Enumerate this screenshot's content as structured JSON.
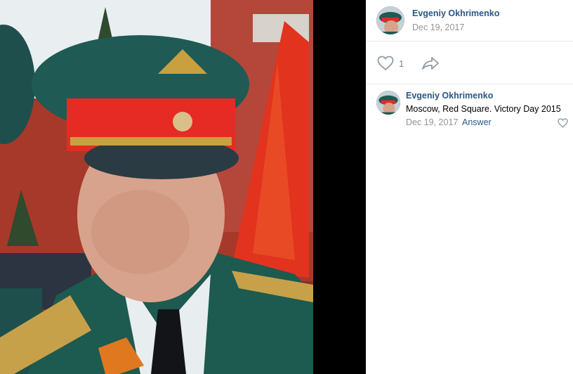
{
  "post": {
    "author": "Evgeniy Okhrimenko",
    "date": "Dec 19, 2017",
    "likes": "1"
  },
  "comment": {
    "author": "Evgeniy Okhrimenko",
    "text": "Moscow, Red Square. Victory Day 2015",
    "date": "Dec 19, 2017",
    "answer_label": "Answer"
  },
  "icons": {
    "like": "heart-icon",
    "share": "share-arrow-icon",
    "comment_like": "heart-icon"
  },
  "colors": {
    "link": "#2a5885",
    "muted": "#939393",
    "divider": "#e7e8ec"
  }
}
